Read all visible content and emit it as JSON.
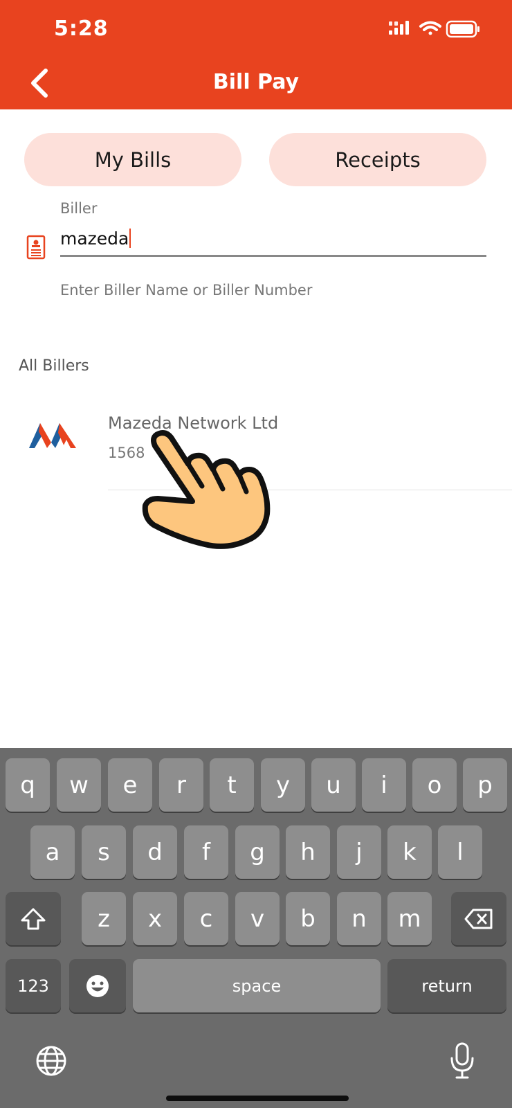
{
  "status_bar": {
    "time": "5:28"
  },
  "header": {
    "title": "Bill Pay"
  },
  "tabs": [
    {
      "label": "My Bills"
    },
    {
      "label": "Receipts"
    }
  ],
  "biller_field": {
    "label": "Biller",
    "value": "mazeda",
    "helper": "Enter Biller Name or Biller Number"
  },
  "section_title": "All Billers",
  "billers": [
    {
      "name": "Mazeda Network Ltd",
      "number": "1568",
      "icon": "mazeda-logo-icon"
    }
  ],
  "keyboard": {
    "row1": [
      "q",
      "w",
      "e",
      "r",
      "t",
      "y",
      "u",
      "i",
      "o",
      "p"
    ],
    "row2": [
      "a",
      "s",
      "d",
      "f",
      "g",
      "h",
      "j",
      "k",
      "l"
    ],
    "row3": [
      "z",
      "x",
      "c",
      "v",
      "b",
      "n",
      "m"
    ],
    "numbers_label": "123",
    "space_label": "space",
    "return_label": "return"
  },
  "colors": {
    "brand": "#e8431f",
    "pill": "#fde0da",
    "keyboard_bg": "#6b6b6b"
  }
}
